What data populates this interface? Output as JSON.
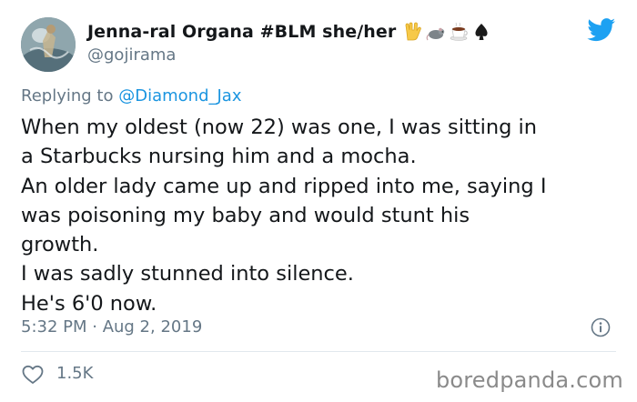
{
  "author": {
    "display_name": "Jenna-ral Organa #BLM she/her",
    "handle": "@gojirama",
    "name_emoji_icons": [
      "vulcan-salute-icon",
      "rat-icon",
      "coffee-icon",
      "spade-icon"
    ]
  },
  "reply": {
    "prefix": "Replying to",
    "mention": "@Diamond_Jax"
  },
  "body_lines": [
    "When my oldest (now 22) was one, I was sitting in",
    "a Starbucks nursing him and a mocha.",
    "An older lady came up and ripped into me, saying I",
    "was poisoning my baby and would stunt his",
    "growth.",
    "I was sadly stunned into silence.",
    "He's 6'0 now."
  ],
  "timestamp": "5:32 PM · Aug 2, 2019",
  "likes": "1.5K",
  "watermark": "boredpanda.com",
  "colors": {
    "twitter_blue": "#1da1f2",
    "link_blue": "#1b95e0",
    "muted_gray": "#657786",
    "text": "#14171a",
    "divider": "#e1e8ed"
  }
}
